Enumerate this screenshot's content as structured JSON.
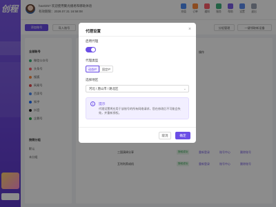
{
  "user": {
    "name_line": "hao0257 欢迎使用聚光播易和哪助体验",
    "expire_line": "有效期限：2028.07.31 16:58:08"
  },
  "top_icons": [
    {
      "label": "充值",
      "color": "#4d8cf5"
    },
    {
      "label": "订单",
      "color": "#ff8a3d"
    },
    {
      "label": "通知",
      "color": "#ff5e6a"
    },
    {
      "label": "服务",
      "color": "#3fb27f"
    },
    {
      "label": "帮助",
      "color": "#7b5be6"
    },
    {
      "label": "设置",
      "color": "#5b8def"
    },
    {
      "label": "退出",
      "color": "#9aa3b2"
    }
  ],
  "toolbar": {
    "add_label": "添加账号",
    "import_label": "导入账号",
    "group_label": "分组管理",
    "batch_label": "一键领取新设备"
  },
  "left_panel": {
    "title": "全部账号",
    "items": [
      {
        "label": "微信公众号",
        "color": "#3fb27f"
      },
      {
        "label": "头条号",
        "color": "#ff5e6a"
      },
      {
        "label": "搜狐",
        "color": "#ff8a3d"
      },
      {
        "label": "网易号",
        "color": "#e5484d"
      },
      {
        "label": "百家号",
        "color": "#4d8cf5"
      },
      {
        "label": "知乎",
        "color": "#1e6fff"
      },
      {
        "label": "抖音",
        "color": "#222222"
      },
      {
        "label": "企鹅号",
        "color": "#2ba24c"
      }
    ],
    "group_title": "按照分组",
    "group_items": [
      "默认",
      "未分组"
    ]
  },
  "table": {
    "header_action": "操作",
    "rows": [
      {
        "name": "三国演绎分享",
        "status": "授权成功"
      },
      {
        "name": "互利利养成机",
        "status": "授权成功"
      }
    ],
    "actions": [
      "重新登录",
      "账号中心",
      "删除账号"
    ]
  },
  "modal": {
    "title": "代理设置",
    "proxy_label": "启用代理",
    "proxy_enabled": true,
    "type_label": "代理类型",
    "type_options": [
      "动态IP",
      "固定IP"
    ],
    "type_selected": "动态IP",
    "region_label": "选择地区",
    "region_value": "河北 / 唐山市 / 路北区",
    "tip_title": "提示",
    "tip_text": "代理设置将应用于该账号的所有网络请求，您在修改后不可能会失效，并重新授权。",
    "cancel_label": "取消",
    "ok_label": "确定"
  }
}
